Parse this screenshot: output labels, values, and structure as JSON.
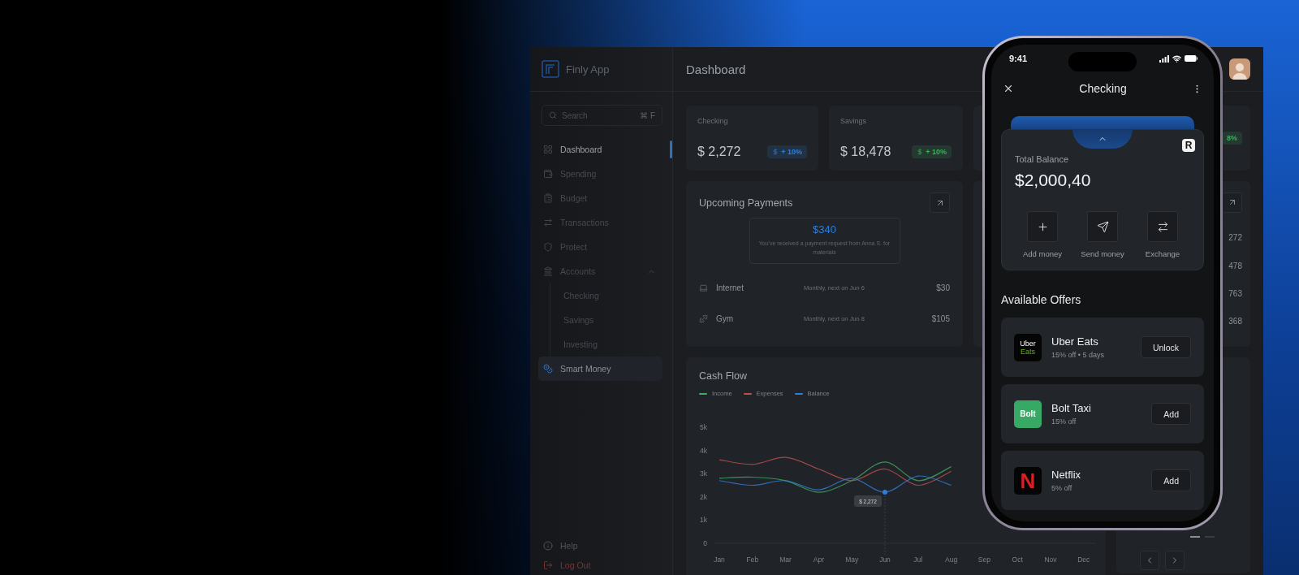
{
  "sidebar": {
    "app_name": "Finly App",
    "search": {
      "placeholder": "Search",
      "shortcut": "⌘ F"
    },
    "items": [
      {
        "label": "Dashboard",
        "selected": true,
        "hovered": false
      },
      {
        "label": "Spending",
        "selected": false,
        "hovered": false
      },
      {
        "label": "Budget",
        "selected": false,
        "hovered": false
      },
      {
        "label": "Transactions",
        "selected": false,
        "hovered": false
      },
      {
        "label": "Protect",
        "selected": false,
        "hovered": false
      },
      {
        "label": "Accounts",
        "selected": false,
        "hovered": false,
        "expanded": true,
        "children": [
          {
            "label": "Checking",
            "selected": false,
            "hovered": false
          },
          {
            "label": "Savings",
            "selected": false,
            "hovered": false
          },
          {
            "label": "Investing",
            "selected": false,
            "hovered": false
          }
        ]
      },
      {
        "label": "Smart Money",
        "selected": false,
        "hovered": true
      }
    ],
    "footer": [
      {
        "label": "Help",
        "kind": "help"
      },
      {
        "label": "Log Out",
        "kind": "logout"
      }
    ]
  },
  "header": {
    "title": "Dashboard"
  },
  "stat_cards": [
    {
      "label": "Checking",
      "amount": "$ 2,272",
      "change": "+ 10%",
      "color": "#2f7fd8"
    },
    {
      "label": "Savings",
      "amount": "$ 18,478",
      "change": "+ 10%",
      "color": "#3fae5e"
    },
    {
      "change": "8%",
      "color": "#3fae5e"
    }
  ],
  "upcoming_payments": {
    "title": "Upcoming Payments",
    "request": {
      "amount": "$340",
      "message": "You've received a payment request from Anna S. for materials"
    },
    "rows": [
      {
        "name": "Internet",
        "schedule": "Monthly, next on Jun 6",
        "amount": "$30"
      },
      {
        "name": "Gym",
        "schedule": "Monthly, next on Jun 8",
        "amount": "$105"
      }
    ]
  },
  "side_panel": {
    "values": [
      "272",
      "478",
      "763",
      "368"
    ]
  },
  "cash_flow": {
    "title": "Cash Flow",
    "chart_data": {
      "type": "line",
      "categories": [
        "Jan",
        "Feb",
        "Mar",
        "Apr",
        "May",
        "Jun",
        "Jul",
        "Aug",
        "Sep",
        "Oct",
        "Nov",
        "Dec"
      ],
      "series": [
        {
          "name": "Income",
          "color": "#3fae5e",
          "values": [
            2800,
            2850,
            2700,
            2200,
            2700,
            3500,
            2700,
            3300,
            null,
            null,
            null,
            null
          ]
        },
        {
          "name": "Expenses",
          "color": "#c0504d",
          "values": [
            3600,
            3400,
            3700,
            3200,
            2700,
            3200,
            2500,
            3100,
            null,
            null,
            null,
            null
          ]
        },
        {
          "name": "Balance",
          "color": "#2f7fd8",
          "values": [
            2700,
            2500,
            2700,
            2300,
            2800,
            2200,
            2900,
            2500,
            null,
            null,
            null,
            null
          ]
        }
      ],
      "ylim": [
        0,
        5000
      ],
      "yticks": [
        {
          "value": 0,
          "label": "0"
        },
        {
          "value": 1000,
          "label": "1k"
        },
        {
          "value": 2000,
          "label": "2k"
        },
        {
          "value": 3000,
          "label": "3k"
        },
        {
          "value": 4000,
          "label": "4k"
        },
        {
          "value": 5000,
          "label": "5k"
        }
      ],
      "annotations": [
        "$ 2,272"
      ]
    }
  },
  "phone": {
    "time": "9:41",
    "title": "Checking",
    "card_logo": "R",
    "balance_label": "Total Balance",
    "balance": "$2,000,40",
    "actions": [
      "Add money",
      "Send money",
      "Exchange"
    ],
    "offers_title": "Available Offers",
    "offers": [
      {
        "name": "Uber Eats",
        "detail": "15% off • 5 days",
        "action": "Unlock",
        "kind": "stacked",
        "logo": [
          "Uber",
          "Eats"
        ]
      },
      {
        "name": "Bolt Taxi",
        "detail": "15% off",
        "action": "Add",
        "kind": "tile",
        "logo": [
          "Bolt"
        ]
      },
      {
        "name": "Netflix",
        "detail": "5% off",
        "action": "Add",
        "kind": "letter",
        "logo": [
          "N"
        ]
      }
    ]
  }
}
